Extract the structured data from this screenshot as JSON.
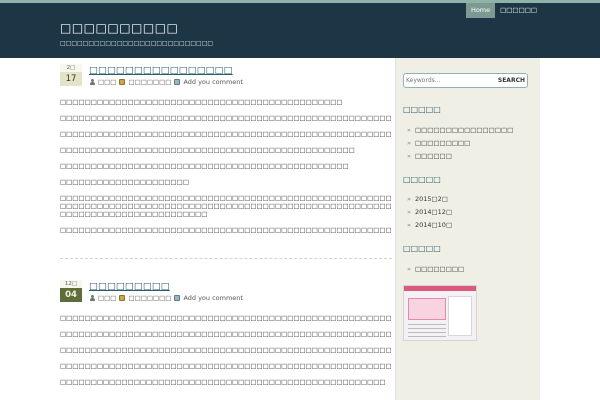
{
  "site": {
    "title": "□□□□□□□□□□",
    "description": "□□□□□□□□□□□□□□□□□□□□□□□□□□□"
  },
  "nav": [
    {
      "label": "Home",
      "active": true
    },
    {
      "label": "□□□□□□",
      "active": false
    }
  ],
  "posts": [
    {
      "month": "2□",
      "day": "17",
      "title": "□□□□□□□□□□□□□□□□",
      "author": "□□□",
      "category": "□□□□□□□",
      "comment_link": "Add you comment",
      "lines": [
        "□□□□□□□□□□□□□□□□□□□□□□□□□□□□□□□□□□□□□□□□□□□□□□",
        "",
        "□□□□□□□□□□□□□□□□□□□□□□□□□□□□□□□□□□□□□□□□□□□□□□□□□□□□□□□□□□□□□□□□□□□□□□□□□□□□□",
        "",
        "□□□□□□□□□□□□□□□□□□□□□□□□□□□□□□□□□□□□□□□□□□□□□□□□□□□□□□□□□□□□□□□□□□□□□",
        "",
        "□□□□□□□□□□□□□□□□□□□□□□□□□□□□□□□□□□□□□□□□□□□□□□□□",
        "",
        "□□□□□□□□□□□□□□□□□□□□□□□□□□□□□□□□□□□□□□□□□□□□□□□",
        "",
        "□□□□□□□□□□□□□□□□□□□□□",
        "",
        "□□□□□□□□□□□□□□□□□□□□□□□□□□□□□□□□□□□□□□□□□□□□□□□□□□□□□□□□□□□□□□□□□□□□□□□□□□□□□□□□□□□",
        "□□□□□□□□□□□□□□□□□□□□□□□□□□□□□□□□□□□□□□□□□□□□□□□□□□□□□□□□□□□□□□□□□□□□□□□□□□□□□□□□□□□",
        "□□□□□□□□□□□□□□□□□□□□□□□□",
        "",
        "□□□□□□□□□□□□□□□□□□□□□□□□□□□□□□□□□□□□□□□□□□□□□□□□□□□□□□□□□□□□"
      ]
    },
    {
      "month": "12□",
      "day": "04",
      "title": "□□□□□□□□□",
      "author": "□□□",
      "category": "□□□□□□□",
      "comment_link": "Add you comment",
      "lines": [
        "□□□□□□□□□□□□□□□□□□□□□□□□□□□□□□□□□□□□□□□□□□□□□□□□□□□□□□□□□□□□□□□□□□□□□□□□□□□□□□□□□□□□□",
        "",
        "□□□□□□□□□□□□□□□□□□□□□□□□□□□□□□□□□□□□□□□□□□□□□□□□□□□□□□□□□□□□□□□□□□□□□□□□□□□□□□□□□",
        "",
        "□□□□□□□□□□□□□□□□□□□□□□□□□□□□□□□□□□□□□□□□□□□□□□□□□□□□□□□□□□",
        "",
        "□□□□□□□□□□□□□□□□□□□□□□□□□□□□□□□□□□□□□□□□□□□□□□□□□□□□□□□□□□□□□□□□□□□□□□□□□□□□□□□□",
        "",
        "□□□□□□□□□□□□□□□□□□□□□□□□□□□□□□□□□□□□□□□□□□□□□□□□□□□□□"
      ]
    }
  ],
  "sidebar": {
    "search": {
      "placeholder": "Keywords...",
      "button": "SEARCH"
    },
    "widgets": [
      {
        "title": "□□□□□",
        "items": [
          "□□□□□□□□□□□□□□□□",
          "□□□□□□□□□",
          "□□□□□□"
        ]
      },
      {
        "title": "□□□□□",
        "items": [
          "2015□2□",
          "2014□12□",
          "2014□10□"
        ]
      },
      {
        "title": "□□□□□",
        "items": [
          "□□□□□□□□"
        ]
      }
    ]
  },
  "colors": {
    "header": "#1d3645",
    "accent": "#7c9a92",
    "link": "#2a5c6e",
    "sidebar": "#efefe6"
  }
}
